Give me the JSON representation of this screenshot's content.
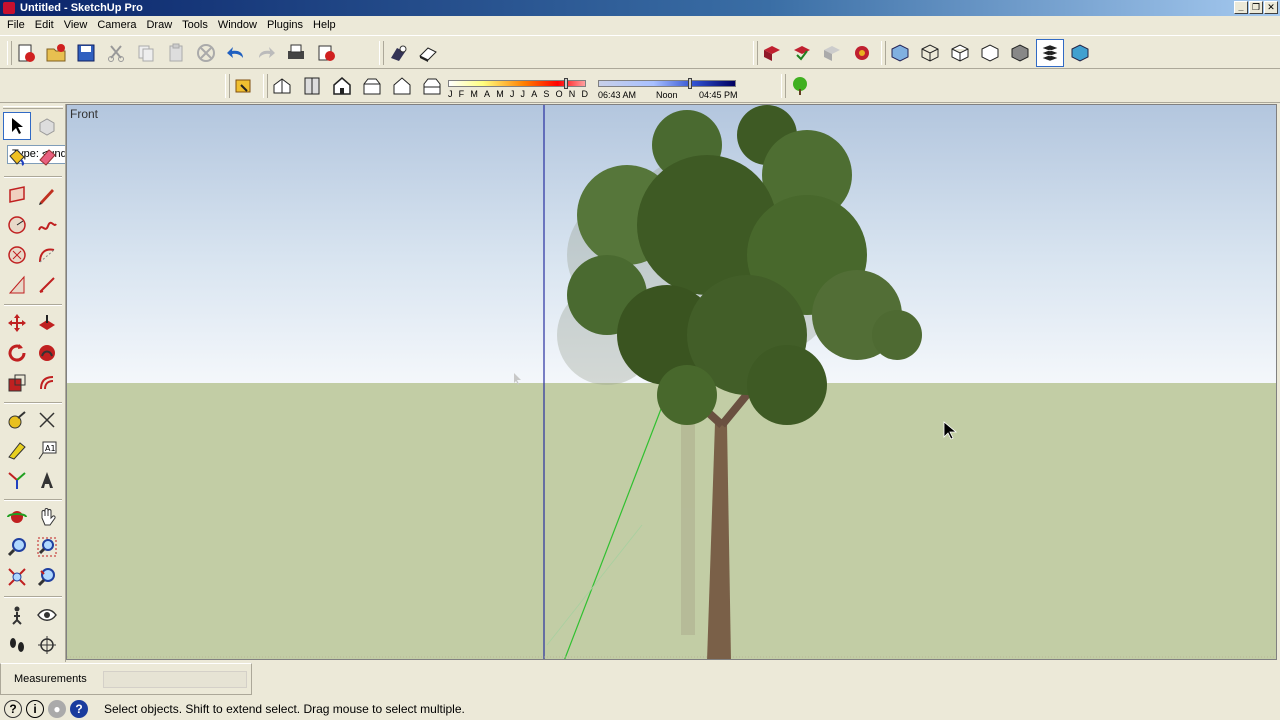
{
  "window": {
    "title": "Untitled - SketchUp Pro"
  },
  "menu": [
    "File",
    "Edit",
    "View",
    "Camera",
    "Draw",
    "Tools",
    "Window",
    "Plugins",
    "Help"
  ],
  "toolbar": {
    "shadow_months": [
      "J",
      "F",
      "M",
      "A",
      "M",
      "J",
      "J",
      "A",
      "S",
      "O",
      "N",
      "D"
    ],
    "shadow_time_start": "06:43 AM",
    "shadow_time_mid": "Noon",
    "shadow_time_end": "04:45 PM",
    "type_combo": "Type: <undefined>"
  },
  "viewport": {
    "view_name": "Front"
  },
  "measurements": {
    "label": "Measurements",
    "value": ""
  },
  "status": {
    "message": "Select objects. Shift to extend select. Drag mouse to select multiple."
  },
  "colors": {
    "sky_top": "#b3c6de",
    "ground": "#c2cda5",
    "axis_blue": "#2830a0",
    "axis_green": "#30c030",
    "foliage": "#3e5a24"
  }
}
